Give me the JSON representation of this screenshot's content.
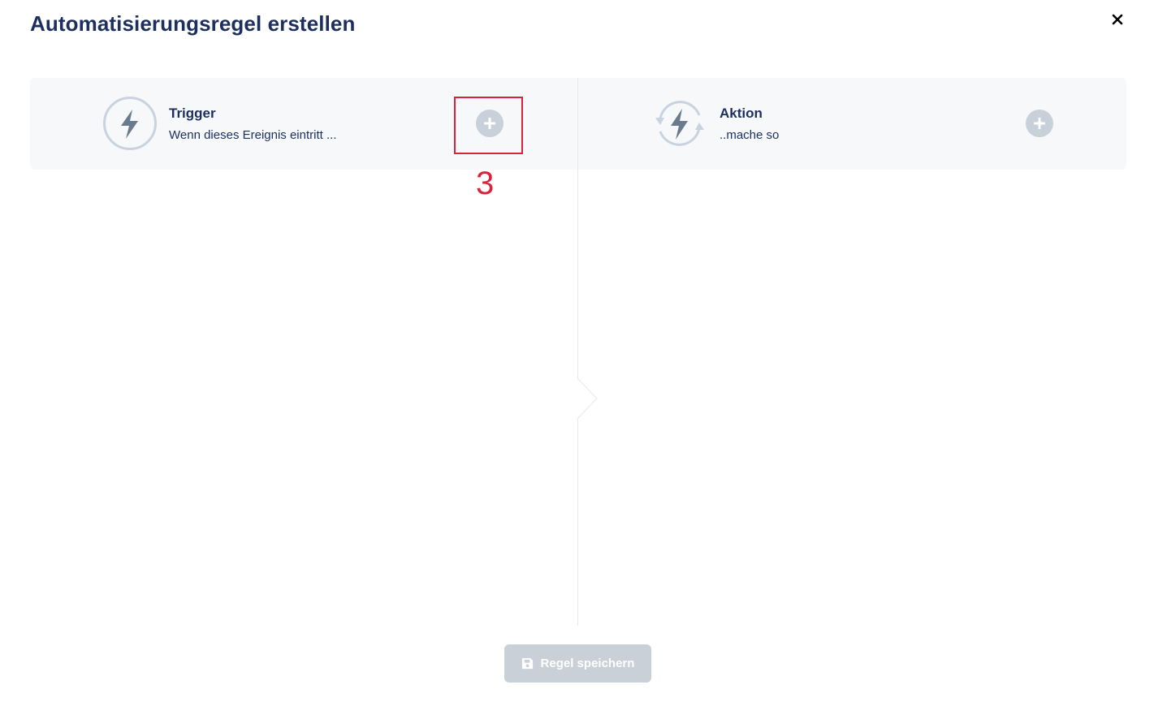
{
  "modal": {
    "title": "Automatisierungsregel erstellen",
    "close_icon": "close-icon"
  },
  "trigger": {
    "title": "Trigger",
    "subtitle": "Wenn dieses Ereignis eintritt ...",
    "icon": "lightning-icon"
  },
  "action": {
    "title": "Aktion",
    "subtitle": "..mache so",
    "icon": "lightning-cycle-icon"
  },
  "annotation": {
    "label": "3"
  },
  "footer": {
    "save_label": "Regel speichern",
    "save_icon": "floppy-disk-icon",
    "save_disabled": true
  },
  "colors": {
    "title": "#1c2f5e",
    "band": "#f6f8fa",
    "plus_button": "#c8d0da",
    "icon_ring": "#c9d3e0",
    "bolt": "#6b7a8c",
    "highlight": "#d9233a",
    "save_disabled": "#c9d0d8"
  }
}
